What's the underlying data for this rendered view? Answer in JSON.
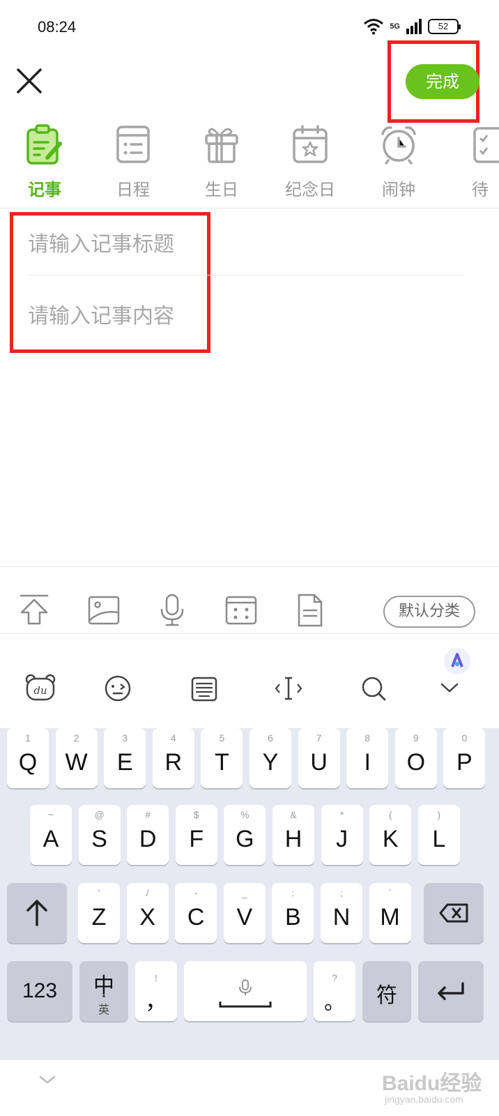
{
  "status_bar": {
    "time": "08:24",
    "network": "5G",
    "battery": "52"
  },
  "header": {
    "done_label": "完成"
  },
  "tabs": [
    {
      "label": "记事",
      "icon": "note-icon",
      "active": true
    },
    {
      "label": "日程",
      "icon": "schedule-icon",
      "active": false
    },
    {
      "label": "生日",
      "icon": "gift-icon",
      "active": false
    },
    {
      "label": "纪念日",
      "icon": "calendar-star-icon",
      "active": false
    },
    {
      "label": "闹钟",
      "icon": "alarm-icon",
      "active": false
    },
    {
      "label": "待",
      "icon": "todo-icon",
      "active": false
    }
  ],
  "note": {
    "title_placeholder": "请输入记事标题",
    "content_placeholder": "请输入记事内容"
  },
  "note_toolbar": {
    "icons": [
      "top-arrow-icon",
      "image-icon",
      "microphone-icon",
      "template-icon",
      "document-icon"
    ],
    "category_label": "默认分类"
  },
  "keyboard": {
    "toolbar_icons": [
      "du-bear-icon",
      "emoji-face-icon",
      "keyboard-layout-icon",
      "cursor-move-icon",
      "search-icon",
      "collapse-chevron-icon"
    ],
    "row1": [
      {
        "main": "Q",
        "sub": "1"
      },
      {
        "main": "W",
        "sub": "2"
      },
      {
        "main": "E",
        "sub": "3"
      },
      {
        "main": "R",
        "sub": "4"
      },
      {
        "main": "T",
        "sub": "5"
      },
      {
        "main": "Y",
        "sub": "6"
      },
      {
        "main": "U",
        "sub": "7"
      },
      {
        "main": "I",
        "sub": "8"
      },
      {
        "main": "O",
        "sub": "9"
      },
      {
        "main": "P",
        "sub": "0"
      }
    ],
    "row2": [
      {
        "main": "A",
        "sub": "~"
      },
      {
        "main": "S",
        "sub": "@"
      },
      {
        "main": "D",
        "sub": "#"
      },
      {
        "main": "F",
        "sub": "$"
      },
      {
        "main": "G",
        "sub": "%"
      },
      {
        "main": "H",
        "sub": "&"
      },
      {
        "main": "J",
        "sub": "*"
      },
      {
        "main": "K",
        "sub": "("
      },
      {
        "main": "L",
        "sub": ")"
      }
    ],
    "row3": [
      {
        "main": "Z",
        "sub": "'"
      },
      {
        "main": "X",
        "sub": "/"
      },
      {
        "main": "C",
        "sub": "-"
      },
      {
        "main": "V",
        "sub": "_"
      },
      {
        "main": "B",
        "sub": ":"
      },
      {
        "main": "N",
        "sub": ";"
      },
      {
        "main": "M",
        "sub": "`"
      }
    ],
    "num_label": "123",
    "lang_label": "中",
    "lang_sub": "英",
    "comma_label": "，",
    "comma_sub": "!",
    "period_label": "。",
    "period_sub": "?",
    "symbol_label": "符"
  },
  "watermark": {
    "brand": "Baidu经验",
    "url": "jingyan.baidu.com"
  }
}
